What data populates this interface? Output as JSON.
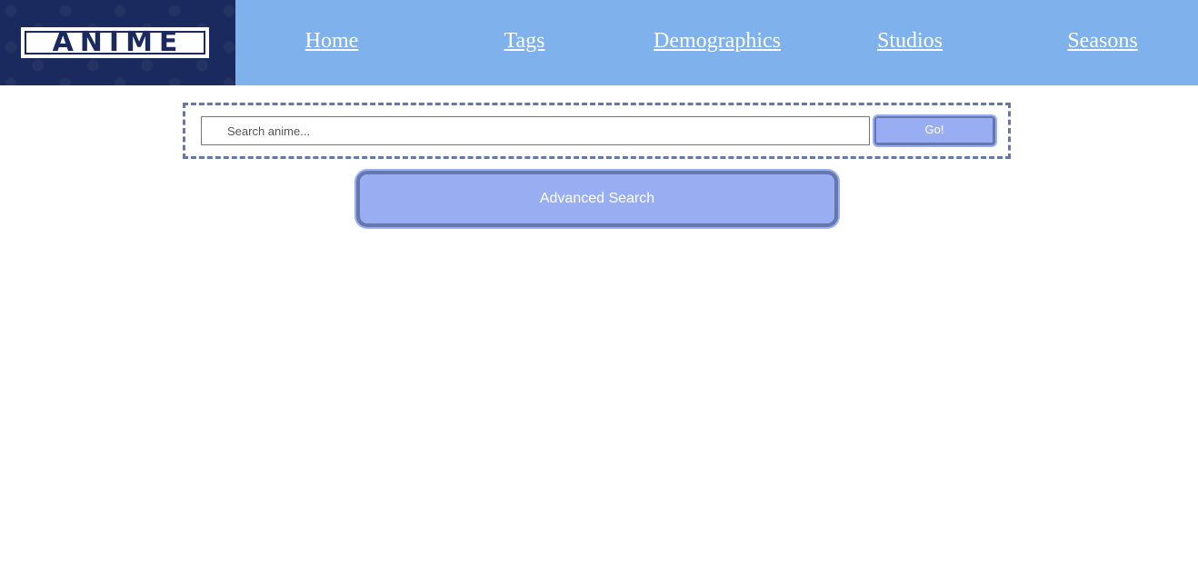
{
  "header": {
    "logo_text": "ANIME",
    "nav": [
      {
        "label": "Home"
      },
      {
        "label": "Tags"
      },
      {
        "label": "Demographics"
      },
      {
        "label": "Studios"
      },
      {
        "label": "Seasons"
      }
    ]
  },
  "search": {
    "placeholder": "Search anime...",
    "value": "",
    "go_label": "Go!"
  },
  "advanced_search": {
    "label": "Advanced Search"
  },
  "colors": {
    "header_bg": "#7fb1ec",
    "logo_bg": "#1b2a5e",
    "button_bg": "#99aef2",
    "button_border": "#6577ad"
  }
}
